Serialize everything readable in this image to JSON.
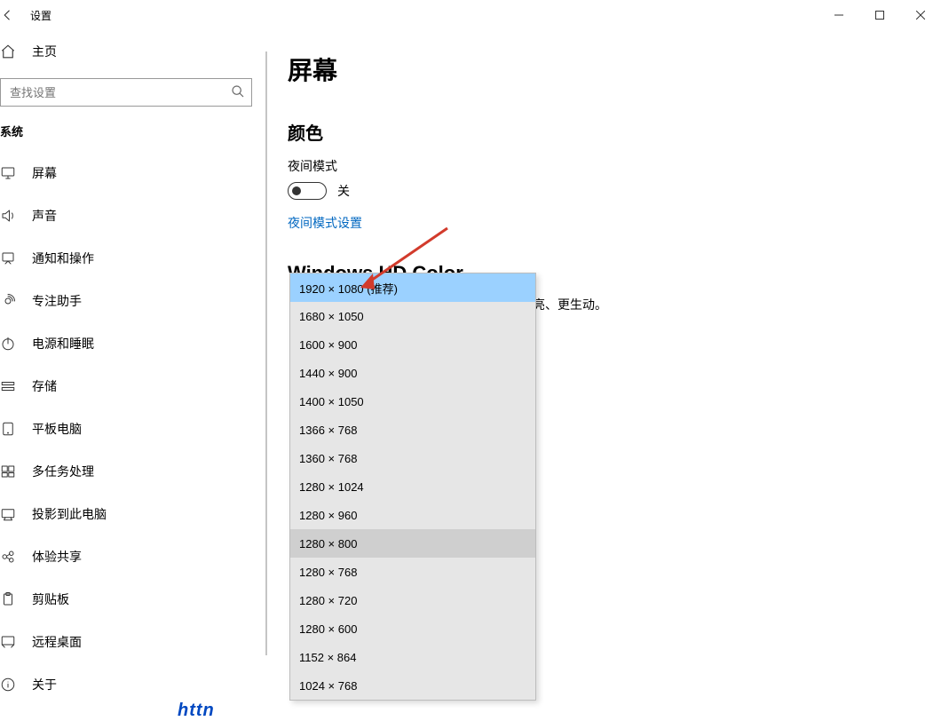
{
  "window": {
    "title": "设置",
    "sysbuttons": [
      "minimize",
      "maximize",
      "close"
    ]
  },
  "sidebar": {
    "home_label": "主页",
    "search_placeholder": "查找设置",
    "group_title": "系统",
    "items": [
      {
        "icon": "display",
        "label": "屏幕",
        "selected": false
      },
      {
        "icon": "sound",
        "label": "声音",
        "selected": false
      },
      {
        "icon": "notify",
        "label": "通知和操作",
        "selected": false
      },
      {
        "icon": "focus",
        "label": "专注助手",
        "selected": false
      },
      {
        "icon": "power",
        "label": "电源和睡眠",
        "selected": false
      },
      {
        "icon": "storage",
        "label": "存储",
        "selected": false
      },
      {
        "icon": "tablet",
        "label": "平板电脑",
        "selected": false
      },
      {
        "icon": "multitask",
        "label": "多任务处理",
        "selected": false
      },
      {
        "icon": "project",
        "label": "投影到此电脑",
        "selected": false
      },
      {
        "icon": "shared",
        "label": "体验共享",
        "selected": false
      },
      {
        "icon": "clipboard",
        "label": "剪贴板",
        "selected": false
      },
      {
        "icon": "remote",
        "label": "远程桌面",
        "selected": false
      },
      {
        "icon": "about",
        "label": "关于",
        "selected": false
      }
    ]
  },
  "main": {
    "page_title": "屏幕",
    "color_heading": "颜色",
    "night_mode_label": "夜间模式",
    "toggle_state": "关",
    "night_mode_link": "夜间模式设置",
    "hd_heading": "Windows HD Color",
    "hd_desc_visible_tail": "亮、更生动。"
  },
  "resolution_dropdown": {
    "options": [
      {
        "label": "1920 × 1080 (推荐)",
        "selected": true,
        "current": false
      },
      {
        "label": "1680 × 1050",
        "selected": false,
        "current": false
      },
      {
        "label": "1600 × 900",
        "selected": false,
        "current": false
      },
      {
        "label": "1440 × 900",
        "selected": false,
        "current": false
      },
      {
        "label": "1400 × 1050",
        "selected": false,
        "current": false
      },
      {
        "label": "1366 × 768",
        "selected": false,
        "current": false
      },
      {
        "label": "1360 × 768",
        "selected": false,
        "current": false
      },
      {
        "label": "1280 × 1024",
        "selected": false,
        "current": false
      },
      {
        "label": "1280 × 960",
        "selected": false,
        "current": false
      },
      {
        "label": "1280 × 800",
        "selected": false,
        "current": true
      },
      {
        "label": "1280 × 768",
        "selected": false,
        "current": false
      },
      {
        "label": "1280 × 720",
        "selected": false,
        "current": false
      },
      {
        "label": "1280 × 600",
        "selected": false,
        "current": false
      },
      {
        "label": "1152 × 864",
        "selected": false,
        "current": false
      },
      {
        "label": "1024 × 768",
        "selected": false,
        "current": false
      }
    ]
  },
  "colors": {
    "accent": "#0078d7",
    "link": "#0067c0",
    "dropdown_bg": "#e6e6e6",
    "dropdown_sel": "#9bd1ff",
    "dropdown_cur": "#cfcfcf",
    "arrow": "#d23b2c"
  },
  "bottom_partial_text": "httn"
}
